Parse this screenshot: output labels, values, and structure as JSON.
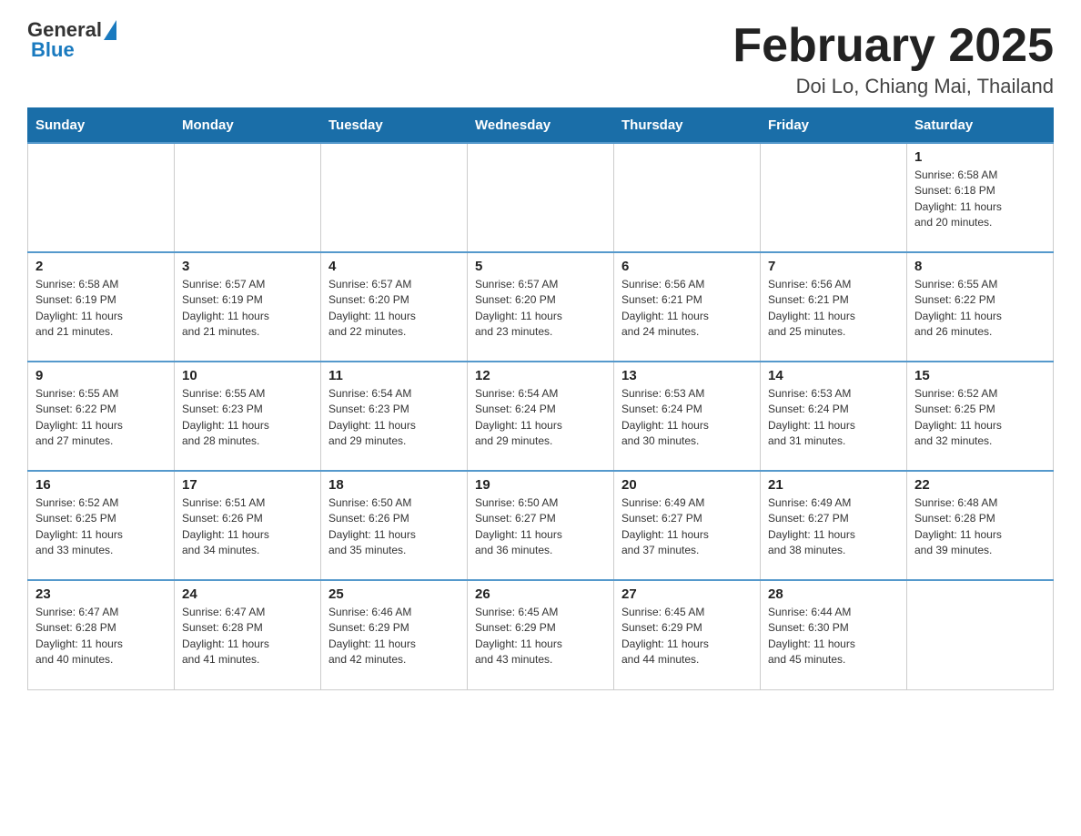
{
  "header": {
    "logo_general": "General",
    "logo_blue": "Blue",
    "title": "February 2025",
    "location": "Doi Lo, Chiang Mai, Thailand"
  },
  "days_of_week": [
    "Sunday",
    "Monday",
    "Tuesday",
    "Wednesday",
    "Thursday",
    "Friday",
    "Saturday"
  ],
  "weeks": [
    [
      {
        "day": "",
        "info": ""
      },
      {
        "day": "",
        "info": ""
      },
      {
        "day": "",
        "info": ""
      },
      {
        "day": "",
        "info": ""
      },
      {
        "day": "",
        "info": ""
      },
      {
        "day": "",
        "info": ""
      },
      {
        "day": "1",
        "info": "Sunrise: 6:58 AM\nSunset: 6:18 PM\nDaylight: 11 hours\nand 20 minutes."
      }
    ],
    [
      {
        "day": "2",
        "info": "Sunrise: 6:58 AM\nSunset: 6:19 PM\nDaylight: 11 hours\nand 21 minutes."
      },
      {
        "day": "3",
        "info": "Sunrise: 6:57 AM\nSunset: 6:19 PM\nDaylight: 11 hours\nand 21 minutes."
      },
      {
        "day": "4",
        "info": "Sunrise: 6:57 AM\nSunset: 6:20 PM\nDaylight: 11 hours\nand 22 minutes."
      },
      {
        "day": "5",
        "info": "Sunrise: 6:57 AM\nSunset: 6:20 PM\nDaylight: 11 hours\nand 23 minutes."
      },
      {
        "day": "6",
        "info": "Sunrise: 6:56 AM\nSunset: 6:21 PM\nDaylight: 11 hours\nand 24 minutes."
      },
      {
        "day": "7",
        "info": "Sunrise: 6:56 AM\nSunset: 6:21 PM\nDaylight: 11 hours\nand 25 minutes."
      },
      {
        "day": "8",
        "info": "Sunrise: 6:55 AM\nSunset: 6:22 PM\nDaylight: 11 hours\nand 26 minutes."
      }
    ],
    [
      {
        "day": "9",
        "info": "Sunrise: 6:55 AM\nSunset: 6:22 PM\nDaylight: 11 hours\nand 27 minutes."
      },
      {
        "day": "10",
        "info": "Sunrise: 6:55 AM\nSunset: 6:23 PM\nDaylight: 11 hours\nand 28 minutes."
      },
      {
        "day": "11",
        "info": "Sunrise: 6:54 AM\nSunset: 6:23 PM\nDaylight: 11 hours\nand 29 minutes."
      },
      {
        "day": "12",
        "info": "Sunrise: 6:54 AM\nSunset: 6:24 PM\nDaylight: 11 hours\nand 29 minutes."
      },
      {
        "day": "13",
        "info": "Sunrise: 6:53 AM\nSunset: 6:24 PM\nDaylight: 11 hours\nand 30 minutes."
      },
      {
        "day": "14",
        "info": "Sunrise: 6:53 AM\nSunset: 6:24 PM\nDaylight: 11 hours\nand 31 minutes."
      },
      {
        "day": "15",
        "info": "Sunrise: 6:52 AM\nSunset: 6:25 PM\nDaylight: 11 hours\nand 32 minutes."
      }
    ],
    [
      {
        "day": "16",
        "info": "Sunrise: 6:52 AM\nSunset: 6:25 PM\nDaylight: 11 hours\nand 33 minutes."
      },
      {
        "day": "17",
        "info": "Sunrise: 6:51 AM\nSunset: 6:26 PM\nDaylight: 11 hours\nand 34 minutes."
      },
      {
        "day": "18",
        "info": "Sunrise: 6:50 AM\nSunset: 6:26 PM\nDaylight: 11 hours\nand 35 minutes."
      },
      {
        "day": "19",
        "info": "Sunrise: 6:50 AM\nSunset: 6:27 PM\nDaylight: 11 hours\nand 36 minutes."
      },
      {
        "day": "20",
        "info": "Sunrise: 6:49 AM\nSunset: 6:27 PM\nDaylight: 11 hours\nand 37 minutes."
      },
      {
        "day": "21",
        "info": "Sunrise: 6:49 AM\nSunset: 6:27 PM\nDaylight: 11 hours\nand 38 minutes."
      },
      {
        "day": "22",
        "info": "Sunrise: 6:48 AM\nSunset: 6:28 PM\nDaylight: 11 hours\nand 39 minutes."
      }
    ],
    [
      {
        "day": "23",
        "info": "Sunrise: 6:47 AM\nSunset: 6:28 PM\nDaylight: 11 hours\nand 40 minutes."
      },
      {
        "day": "24",
        "info": "Sunrise: 6:47 AM\nSunset: 6:28 PM\nDaylight: 11 hours\nand 41 minutes."
      },
      {
        "day": "25",
        "info": "Sunrise: 6:46 AM\nSunset: 6:29 PM\nDaylight: 11 hours\nand 42 minutes."
      },
      {
        "day": "26",
        "info": "Sunrise: 6:45 AM\nSunset: 6:29 PM\nDaylight: 11 hours\nand 43 minutes."
      },
      {
        "day": "27",
        "info": "Sunrise: 6:45 AM\nSunset: 6:29 PM\nDaylight: 11 hours\nand 44 minutes."
      },
      {
        "day": "28",
        "info": "Sunrise: 6:44 AM\nSunset: 6:30 PM\nDaylight: 11 hours\nand 45 minutes."
      },
      {
        "day": "",
        "info": ""
      }
    ]
  ]
}
